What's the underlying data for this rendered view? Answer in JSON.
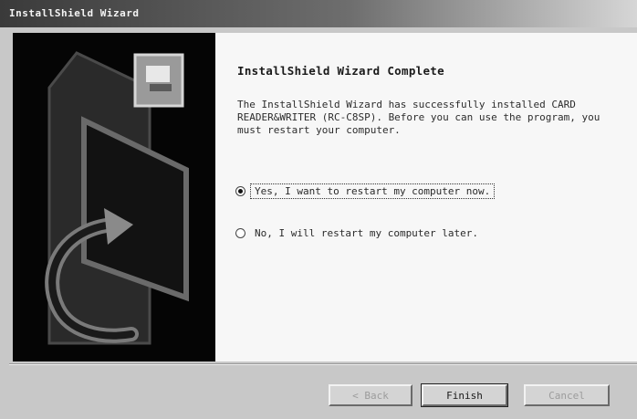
{
  "window": {
    "title": "InstallShield Wizard"
  },
  "content": {
    "heading": "InstallShield Wizard Complete",
    "body": "The InstallShield Wizard has successfully installed CARD READER&WRITER (RC-C8SP). Before you can use the program, you must restart your computer.",
    "options": [
      {
        "label": "Yes, I want to restart my computer now.",
        "selected": true
      },
      {
        "label": "No, I will restart my computer later.",
        "selected": false
      }
    ]
  },
  "buttons": {
    "back": "< Back",
    "finish": "Finish",
    "cancel": "Cancel"
  },
  "colors": {
    "side_panel": "#050505",
    "content_bg": "#f7f7f7",
    "window_bg": "#c8c8c8"
  }
}
